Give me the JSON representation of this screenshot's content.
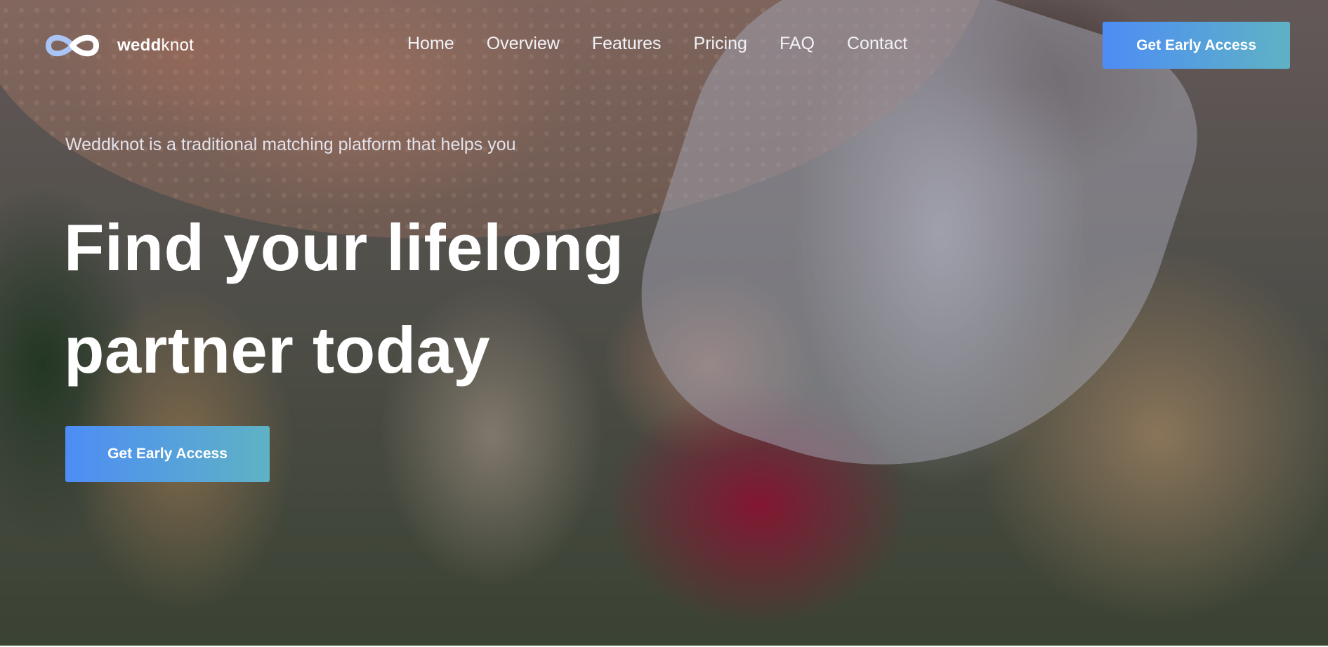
{
  "brand": {
    "name_bold": "wedd",
    "name_light": "knot",
    "logo_icon": "infinity-rings-icon"
  },
  "nav": {
    "links": [
      "Home",
      "Overview",
      "Features",
      "Pricing",
      "FAQ",
      "Contact"
    ],
    "cta_label": "Get Early Access"
  },
  "hero": {
    "tagline": "Weddknot is a traditional matching platform that helps you",
    "headline_line1": "Find your lifelong",
    "headline_line2": "partner today",
    "cta_label": "Get Early Access",
    "background_image": "wedding-couple-under-canopy"
  },
  "colors": {
    "cta_gradient_start": "#4d8df5",
    "cta_gradient_end": "#5fb2c4",
    "text": "#ffffff"
  }
}
